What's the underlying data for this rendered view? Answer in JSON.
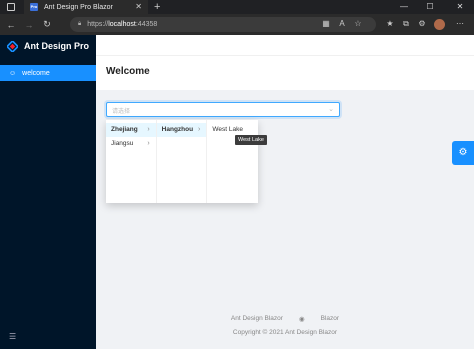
{
  "browser": {
    "tab_title": "Ant Design Pro Blazor",
    "favicon_text": "Pro",
    "url_prefix": "https://",
    "url_host": "localhost",
    "url_port": ":44358"
  },
  "app": {
    "logo_text": "Ant Design Pro",
    "brand_color": "#1890ff",
    "sider_color": "#001529"
  },
  "sidebar": {
    "items": [
      {
        "label": "welcome",
        "icon": "smile-icon",
        "active": true
      }
    ]
  },
  "page": {
    "title": "Welcome"
  },
  "cascader": {
    "placeholder": "请选择",
    "columns": [
      [
        {
          "label": "Zhejiang",
          "active": true,
          "has_children": true
        },
        {
          "label": "Jiangsu",
          "active": false,
          "has_children": true
        }
      ],
      [
        {
          "label": "Hangzhou",
          "active": true,
          "has_children": true
        }
      ],
      [
        {
          "label": "West Lake",
          "active": false,
          "has_children": false
        }
      ]
    ],
    "tooltip": "West Lake"
  },
  "footer": {
    "link_left": "Ant Design Blazor",
    "link_icon": "github-icon",
    "link_right": "Blazor",
    "copyright": "Copyright © 2021 Ant Design Blazor"
  }
}
